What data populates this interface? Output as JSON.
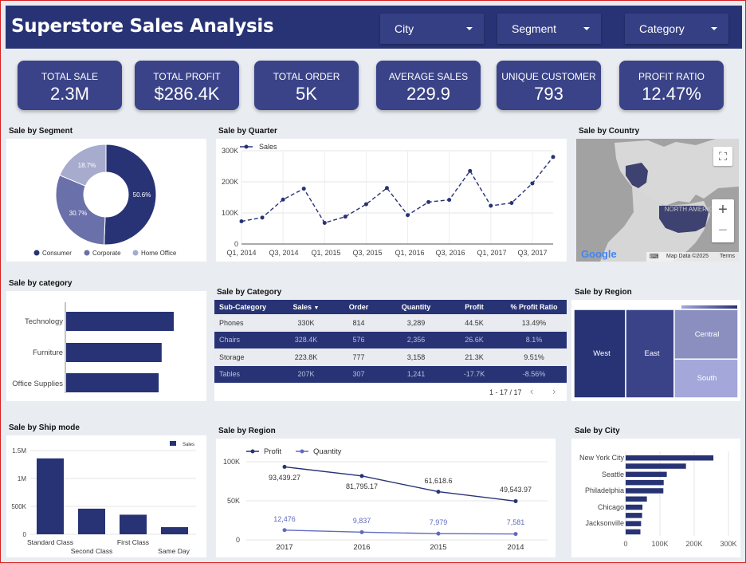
{
  "header": {
    "title": "Superstore Sales Analysis"
  },
  "filters": [
    {
      "label": "City"
    },
    {
      "label": "Segment"
    },
    {
      "label": "Category"
    }
  ],
  "kpis": [
    {
      "label": "TOTAL SALE",
      "value": "2.3M"
    },
    {
      "label": "TOTAL PROFIT",
      "value": "$286.4K"
    },
    {
      "label": "TOTAL ORDER",
      "value": "5K"
    },
    {
      "label": "AVERAGE SALES",
      "value": "229.9"
    },
    {
      "label": "UNIQUE CUSTOMER",
      "value": "793"
    },
    {
      "label": "PROFIT RATIO",
      "value": "12.47%"
    }
  ],
  "sections": {
    "segment": "Sale by Segment",
    "quarter": "Sale by Quarter",
    "country": "Sale by Country",
    "category_bar": "Sale by category",
    "category_table": "Sale by Category",
    "region_tree": "Sale by Region",
    "shipmode": "Sale by Ship mode",
    "region_line": "Sale by Region",
    "city": "Sale by City"
  },
  "colors": {
    "navy": "#283375",
    "mid": "#6a70a9",
    "light": "#a7abcd",
    "bg": "#e9ecf1"
  },
  "map": {
    "fullscreen_icon": "fullscreen-icon",
    "zoom_in_icon": "plus-icon",
    "zoom_out_icon": "minus-icon",
    "label": "NORTH AMERICA",
    "logo": "Google",
    "attribution": "Map Data ©2025",
    "terms": "Terms",
    "keyboard_icon": "keyboard-icon"
  },
  "table": {
    "headers": [
      "Sub-Category",
      "Sales",
      "Order",
      "Quantity",
      "Profit",
      "% Profit Ratio"
    ],
    "sort_icon": "sort-desc-icon",
    "rows": [
      [
        "Phones",
        "330K",
        "814",
        "3,289",
        "44.5K",
        "13.49%"
      ],
      [
        "Chairs",
        "328.4K",
        "576",
        "2,356",
        "26.6K",
        "8.1%"
      ],
      [
        "Storage",
        "223.8K",
        "777",
        "3,158",
        "21.3K",
        "9.51%"
      ],
      [
        "Tables",
        "207K",
        "307",
        "1,241",
        "-17.7K",
        "-8.56%"
      ]
    ],
    "pagination": "1 - 17 / 17"
  },
  "chart_data": [
    {
      "id": "segment",
      "type": "pie",
      "categories": [
        "Consumer",
        "Corporate",
        "Home Office"
      ],
      "values": [
        50.6,
        30.7,
        18.7
      ],
      "labels": [
        "50.6%",
        "30.7%",
        "18.7%"
      ],
      "colors": [
        "#283375",
        "#6a70a9",
        "#a7abcd"
      ],
      "legend": "bottom"
    },
    {
      "id": "quarter",
      "type": "line",
      "series": [
        {
          "name": "Sales",
          "values": [
            73000,
            85000,
            143000,
            178000,
            68000,
            88000,
            128000,
            180000,
            93000,
            135000,
            142000,
            235000,
            123000,
            132000,
            195000,
            280000
          ]
        }
      ],
      "x": [
        "Q1, 2014",
        "Q2, 2014",
        "Q3, 2014",
        "Q4, 2014",
        "Q1, 2015",
        "Q2, 2015",
        "Q3, 2015",
        "Q4, 2015",
        "Q1, 2016",
        "Q2, 2016",
        "Q3, 2016",
        "Q4, 2016",
        "Q1, 2017",
        "Q2, 2017",
        "Q3, 2017",
        "Q4, 2017"
      ],
      "xtick_labels": [
        "Q1, 2014",
        "Q3, 2014",
        "Q1, 2015",
        "Q3, 2015",
        "Q1, 2016",
        "Q3, 2016",
        "Q1, 2017",
        "Q3, 2017"
      ],
      "yticks": [
        "0",
        "100K",
        "200K",
        "300K"
      ],
      "ylim": [
        0,
        300000
      ],
      "legend": "top-left",
      "grid": true
    },
    {
      "id": "category",
      "type": "bar",
      "orientation": "horizontal",
      "categories": [
        "Technology",
        "Furniture",
        "Office Supplies"
      ],
      "values": [
        836000,
        742000,
        719000
      ]
    },
    {
      "id": "region_treemap",
      "type": "treemap",
      "categories": [
        "West",
        "East",
        "Central",
        "South"
      ],
      "values": [
        725000,
        679000,
        501000,
        392000
      ],
      "colors": [
        "#283375",
        "#3a4388",
        "#8a8fc0",
        "#a3a7da"
      ]
    },
    {
      "id": "shipmode",
      "type": "bar",
      "categories": [
        "Standard Class",
        "Second Class",
        "First Class",
        "Same Day"
      ],
      "values": [
        1360000,
        459000,
        351000,
        128000
      ],
      "series": [
        {
          "name": "Sales"
        }
      ],
      "yticks": [
        "0",
        "500K",
        "1M",
        "1.5M"
      ],
      "ylim": [
        0,
        1500000
      ],
      "legend": "top-right",
      "grid": true
    },
    {
      "id": "region_line",
      "type": "line",
      "x": [
        "2017",
        "2016",
        "2015",
        "2014"
      ],
      "series": [
        {
          "name": "Profit",
          "values": [
            93439.27,
            81795.17,
            61618.6,
            49543.97
          ],
          "labels": [
            "93,439.27",
            "81,795.17",
            "61,618.6",
            "49,543.97"
          ]
        },
        {
          "name": "Quantity",
          "values": [
            12476,
            9837,
            7979,
            7581
          ],
          "labels": [
            "12,476",
            "9,837",
            "7,979",
            "7,581"
          ]
        }
      ],
      "yticks": [
        "0",
        "50K",
        "100K"
      ],
      "ylim": [
        0,
        100000
      ],
      "legend": "top-left",
      "grid": true
    },
    {
      "id": "city",
      "type": "bar",
      "orientation": "horizontal",
      "categories": [
        "New York City",
        "",
        "Seattle",
        "",
        "Philadelphia",
        "",
        "Chicago",
        "",
        "Jacksonville",
        ""
      ],
      "values": [
        256000,
        176000,
        120000,
        111000,
        110000,
        62000,
        49000,
        48000,
        45000,
        43000
      ],
      "xticks": [
        "0",
        "100K",
        "200K",
        "300K"
      ],
      "xlim": [
        0,
        300000
      ],
      "grid": true
    }
  ]
}
